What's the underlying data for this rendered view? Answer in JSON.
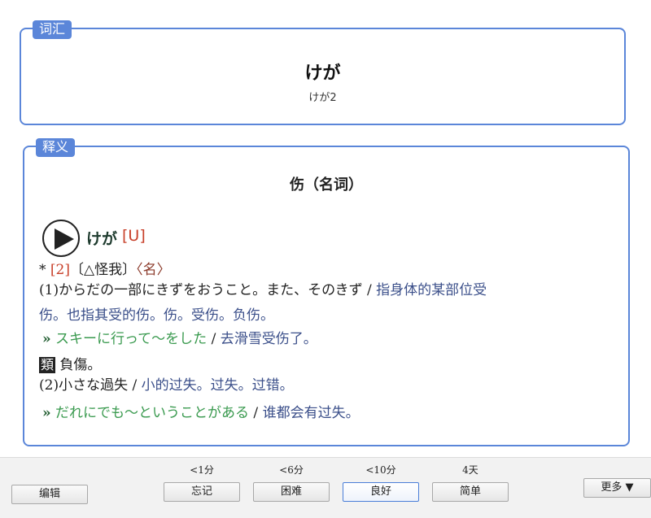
{
  "vocab": {
    "legend": "词汇",
    "word": "けが",
    "reading": "けが2"
  },
  "meaning": {
    "legend": "释义",
    "title": "伤（名词）",
    "head_word": "けが",
    "head_tag": "[U]",
    "entry_star": "*",
    "entry_num": "[2]",
    "entry_kanji": "〔△怪我〕",
    "entry_pos": "〈名〉",
    "sense1_ja": "(1)からだの一部にきずをおうこと。また、そのきず",
    "sep": " / ",
    "sense1_zh_a": "指身体的某部位受",
    "sense1_zh_b": "伤。也指其受的伤。伤。受伤。负伤。",
    "ex1_marker": "»",
    "ex1_ja": "スキーに行って〜をした",
    "ex1_zh": "去滑雪受伤了。",
    "syn_label": "類",
    "syn_word": "負傷。",
    "sense2_ja": "(2)小さな過失",
    "sense2_zh": "小的过失。过失。过错。",
    "ex2_marker": "»",
    "ex2_ja": "だれにでも〜ということがある",
    "ex2_zh": "谁都会有过失。"
  },
  "bottom": {
    "edit": "编辑",
    "again_time": "<1分",
    "again": "忘记",
    "hard_time": "<6分",
    "hard": "困难",
    "good_time": "<10分",
    "good": "良好",
    "easy_time": "4天",
    "easy": "简单",
    "more": "更多 ▼"
  }
}
